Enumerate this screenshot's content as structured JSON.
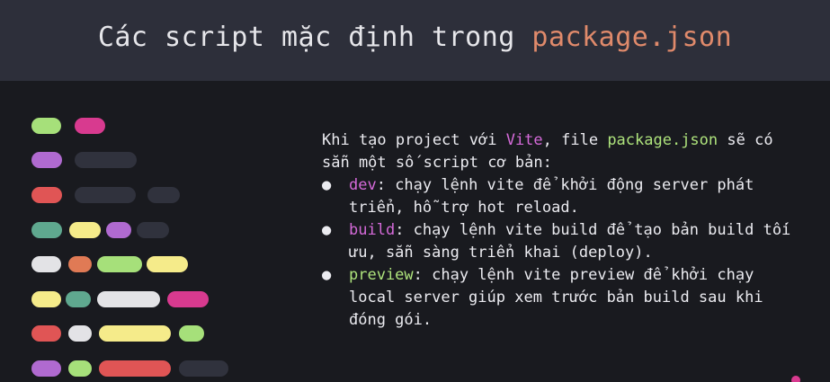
{
  "header": {
    "title_prefix": "Các script mặc định trong ",
    "title_highlight": "package.json"
  },
  "intro": {
    "part1": "Khi tạo project với ",
    "vite": "Vite",
    "part2": ", file ",
    "package_json": "package.json",
    "part3": " sẽ có sẵn một số script cơ bản:"
  },
  "scripts": [
    {
      "name": "dev",
      "desc": ": chạy lệnh vite để khởi động server phát triển, hỗ trợ hot reload.",
      "color": "#d56ad9"
    },
    {
      "name": "build",
      "desc": ": chạy lệnh vite build để tạo bản build tối ưu, sẵn sàng triển khai (deploy).",
      "color": "#d56ad9"
    },
    {
      "name": "preview",
      "desc": ": chạy lệnh vite preview để khởi chạy local server giúp xem trước bản build sau khi đóng gói.",
      "color": "#aee37c"
    }
  ],
  "bullet_char": "●",
  "colors": {
    "background": "#191a1f",
    "header": "#2d2f3a",
    "accent_orange": "#e08a6b",
    "keyword_pink": "#d56ad9",
    "keyword_green": "#aee37c"
  }
}
